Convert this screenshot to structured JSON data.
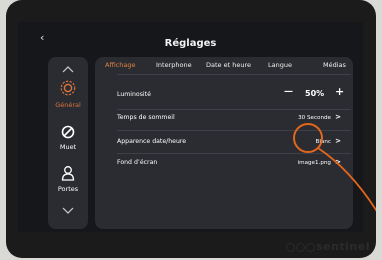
{
  "header": {
    "back_icon": "‹",
    "title": "Réglages"
  },
  "sidebar": {
    "items": [
      {
        "label": "Général",
        "icon": "gear-icon",
        "active": true
      },
      {
        "label": "Muet",
        "icon": "mute-icon"
      },
      {
        "label": "Portes",
        "icon": "person-icon"
      }
    ]
  },
  "tabs": [
    {
      "label": "Affichage",
      "active": true
    },
    {
      "label": "Interphone"
    },
    {
      "label": "Date et heure"
    },
    {
      "label": "Langue"
    },
    {
      "label": "Médias"
    }
  ],
  "settings": {
    "brightness": {
      "label": "Luminosité",
      "minus": "—",
      "value": "50%",
      "plus": "+"
    },
    "sleep": {
      "label": "Temps de sommeil",
      "value": "30 Seconde"
    },
    "datetime_look": {
      "label": "Apparence date/heure",
      "value": "Blanc"
    },
    "wallpaper": {
      "label": "Fond d’écran",
      "value": "image1.png"
    }
  },
  "brand": {
    "name": "sentinel"
  },
  "colors": {
    "accent": "#e38142",
    "panel": "#2a2c31",
    "screen": "#16171b"
  }
}
